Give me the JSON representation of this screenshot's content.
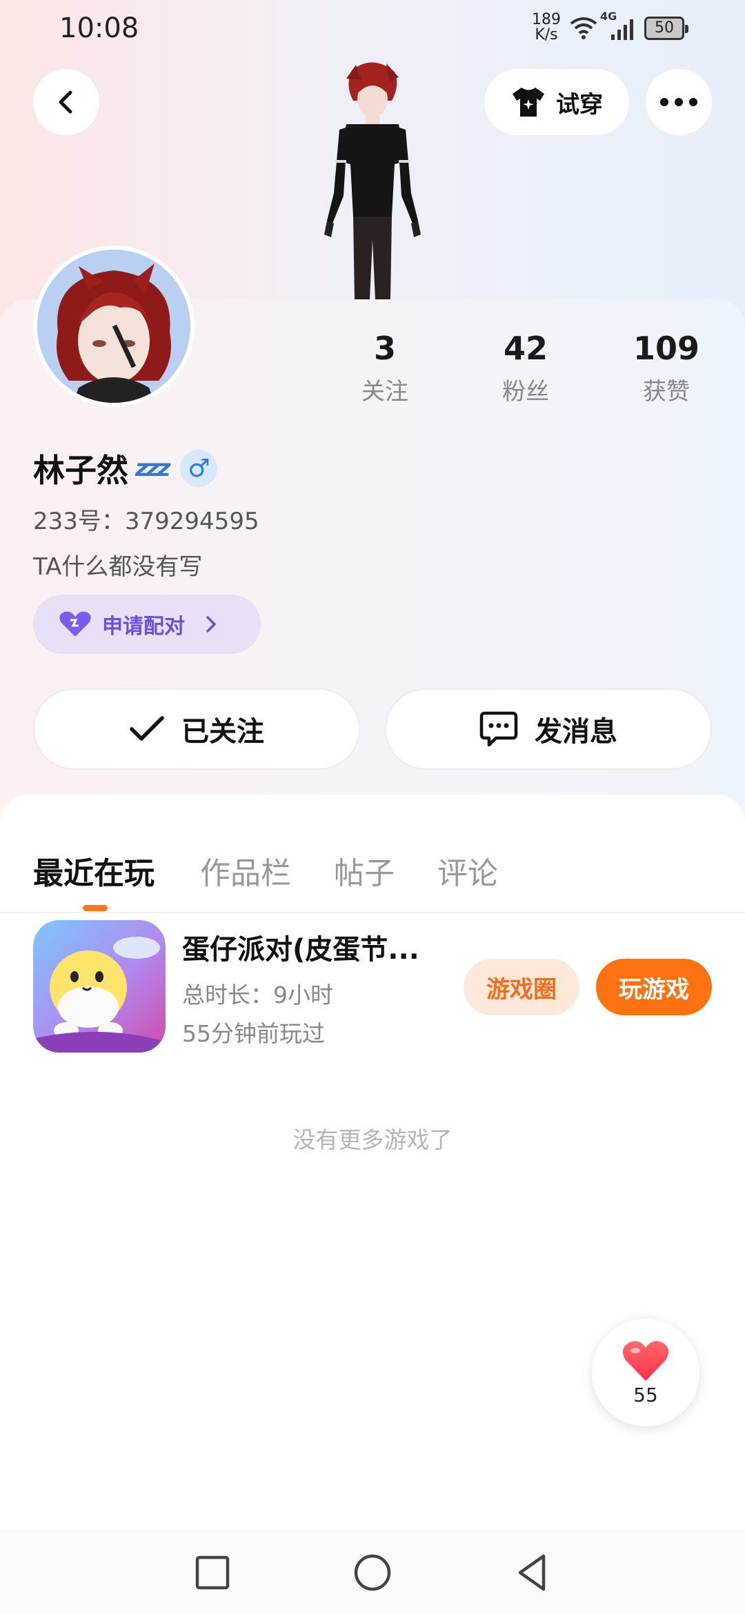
{
  "status_bar": {
    "time": "10:08",
    "net_speed_value": "189",
    "net_speed_unit": "K/s",
    "network_type": "4G",
    "battery": "50"
  },
  "header": {
    "try_on_label": "试穿",
    "more_label": "•••"
  },
  "profile": {
    "stats": [
      {
        "value": "3",
        "label": "关注"
      },
      {
        "value": "42",
        "label": "粉丝"
      },
      {
        "value": "109",
        "label": "获赞"
      }
    ],
    "username": "林子然",
    "status_emoji": "zzz",
    "gender_symbol": "♂",
    "user_id": "233号：379294595",
    "bio": "TA什么都没有写",
    "pair_label": "申请配对",
    "follow_label": "已关注",
    "message_label": "发消息"
  },
  "tabs": [
    {
      "label": "最近在玩",
      "active": true
    },
    {
      "label": "作品栏",
      "active": false
    },
    {
      "label": "帖子",
      "active": false
    },
    {
      "label": "评论",
      "active": false
    }
  ],
  "games": [
    {
      "title": "蛋仔派对(皮蛋节...",
      "total_time": "总时长：9小时",
      "last_played": "55分钟前玩过",
      "circle_label": "游戏圈",
      "play_label": "玩游戏"
    }
  ],
  "no_more_text": "没有更多游戏了",
  "like_count": "55",
  "colors": {
    "accent_orange": "#ff7212",
    "pair_purple": "#6a4fd8",
    "like_red": "#ff4a4f"
  }
}
